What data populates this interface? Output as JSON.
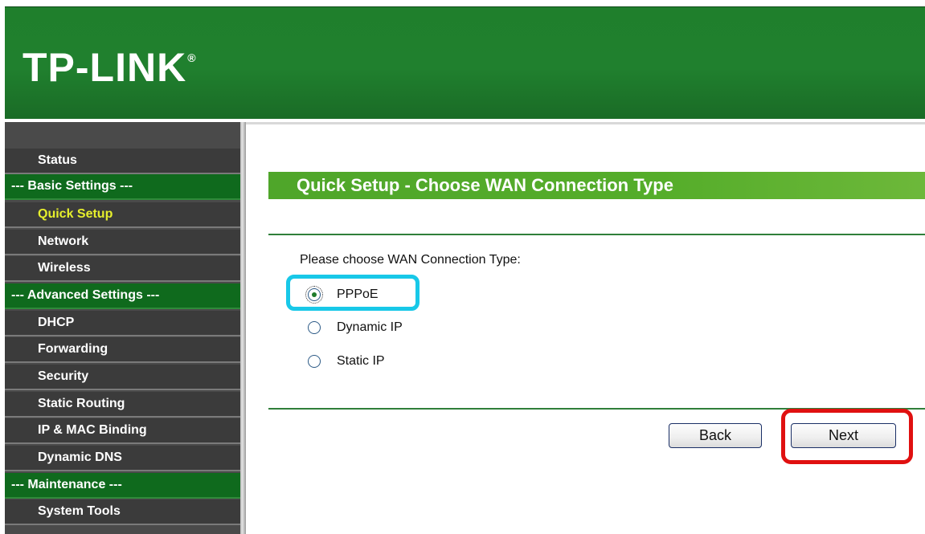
{
  "brand": {
    "logo_text": "TP-LINK",
    "logo_mark": "®"
  },
  "sidebar": {
    "items": [
      {
        "label": "Status",
        "type": "normal",
        "active": false
      },
      {
        "label": "--- Basic Settings ---",
        "type": "section",
        "active": false
      },
      {
        "label": "Quick Setup",
        "type": "normal",
        "active": true
      },
      {
        "label": "Network",
        "type": "normal",
        "active": false
      },
      {
        "label": "Wireless",
        "type": "normal",
        "active": false
      },
      {
        "label": "--- Advanced Settings ---",
        "type": "section",
        "active": false
      },
      {
        "label": "DHCP",
        "type": "normal",
        "active": false
      },
      {
        "label": "Forwarding",
        "type": "normal",
        "active": false
      },
      {
        "label": "Security",
        "type": "normal",
        "active": false
      },
      {
        "label": "Static Routing",
        "type": "normal",
        "active": false
      },
      {
        "label": "IP & MAC Binding",
        "type": "normal",
        "active": false
      },
      {
        "label": "Dynamic DNS",
        "type": "normal",
        "active": false
      },
      {
        "label": "--- Maintenance ---",
        "type": "section",
        "active": false
      },
      {
        "label": "System Tools",
        "type": "normal",
        "active": false
      }
    ]
  },
  "main": {
    "title": "Quick Setup - Choose WAN Connection Type",
    "prompt": "Please choose WAN Connection Type:",
    "options": [
      {
        "label": "PPPoE",
        "checked": true
      },
      {
        "label": "Dynamic IP",
        "checked": false
      },
      {
        "label": "Static IP",
        "checked": false
      }
    ],
    "back_label": "Back",
    "next_label": "Next"
  },
  "colors": {
    "header_green": "#20802e",
    "section_green": "#0f6a1d",
    "title_bar_green": "#55ad2a",
    "active_menu_text": "#e6ef2c",
    "annotation_cyan": "#18c8e8",
    "annotation_red": "#e01010"
  }
}
